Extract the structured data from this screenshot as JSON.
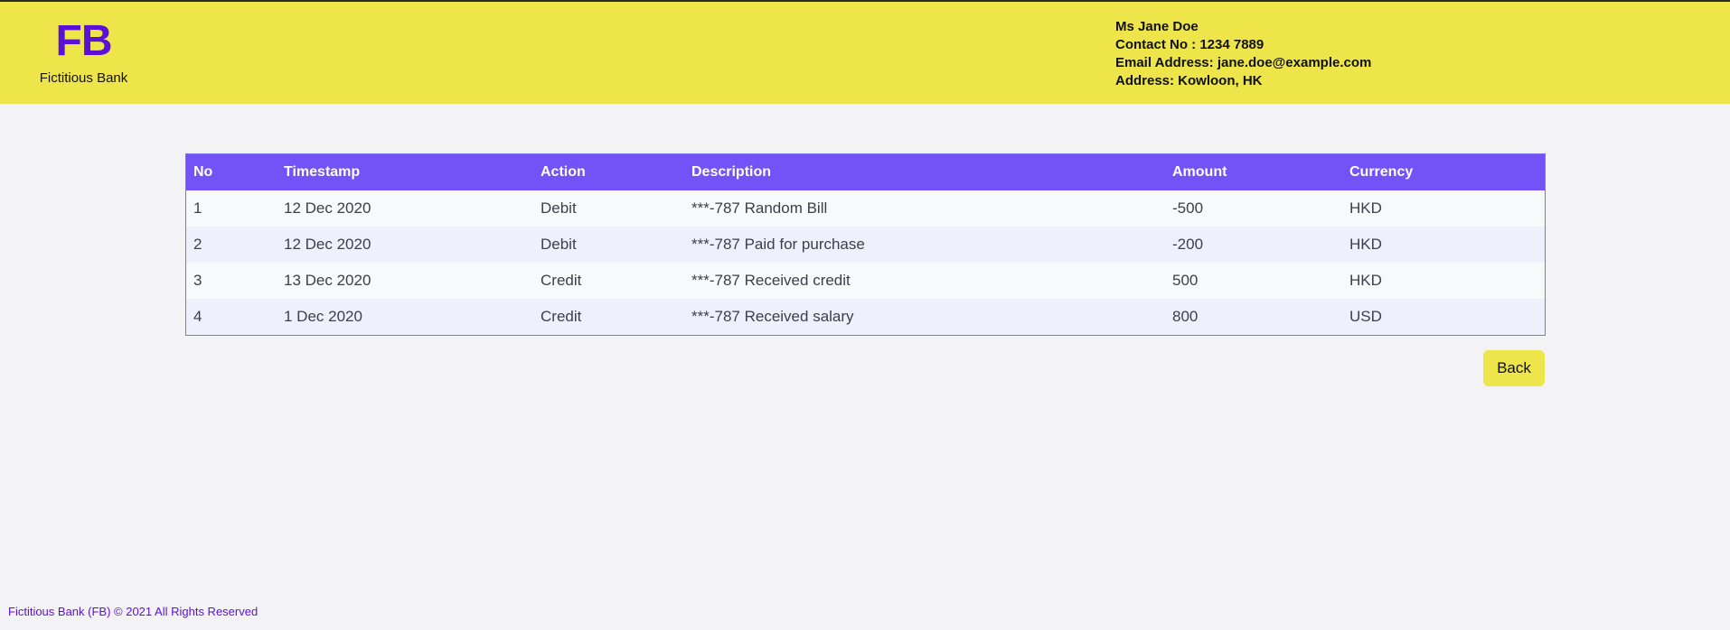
{
  "header": {
    "logo_mark": "FB",
    "logo_name": "Fictitious Bank",
    "contact": {
      "name": "Ms Jane Doe",
      "phone": "Contact No : 1234 7889",
      "email": "Email Address: jane.doe@example.com",
      "address": "Address: Kowloon, HK"
    }
  },
  "colors": {
    "header_bg": "#ede54a",
    "brand": "#5b10d8",
    "table_header_bg": "#7352f8",
    "page_bg": "#f3f3f5"
  },
  "transactions": {
    "columns": [
      "No",
      "Timestamp",
      "Action",
      "Description",
      "Amount",
      "Currency"
    ],
    "rows": [
      [
        "1",
        "12 Dec 2020",
        "Debit",
        "***-787 Random Bill",
        "-500",
        "HKD"
      ],
      [
        "2",
        "12 Dec 2020",
        "Debit",
        "***-787 Paid for purchase",
        "-200",
        "HKD"
      ],
      [
        "3",
        "13 Dec 2020",
        "Credit",
        "***-787 Received credit",
        "500",
        "HKD"
      ],
      [
        "4",
        "1 Dec 2020",
        "Credit",
        "***-787 Received salary",
        "800",
        "USD"
      ]
    ]
  },
  "actions": {
    "back_label": "Back"
  },
  "footer": {
    "text": "Fictitious Bank (FB) © 2021 All Rights Reserved"
  }
}
